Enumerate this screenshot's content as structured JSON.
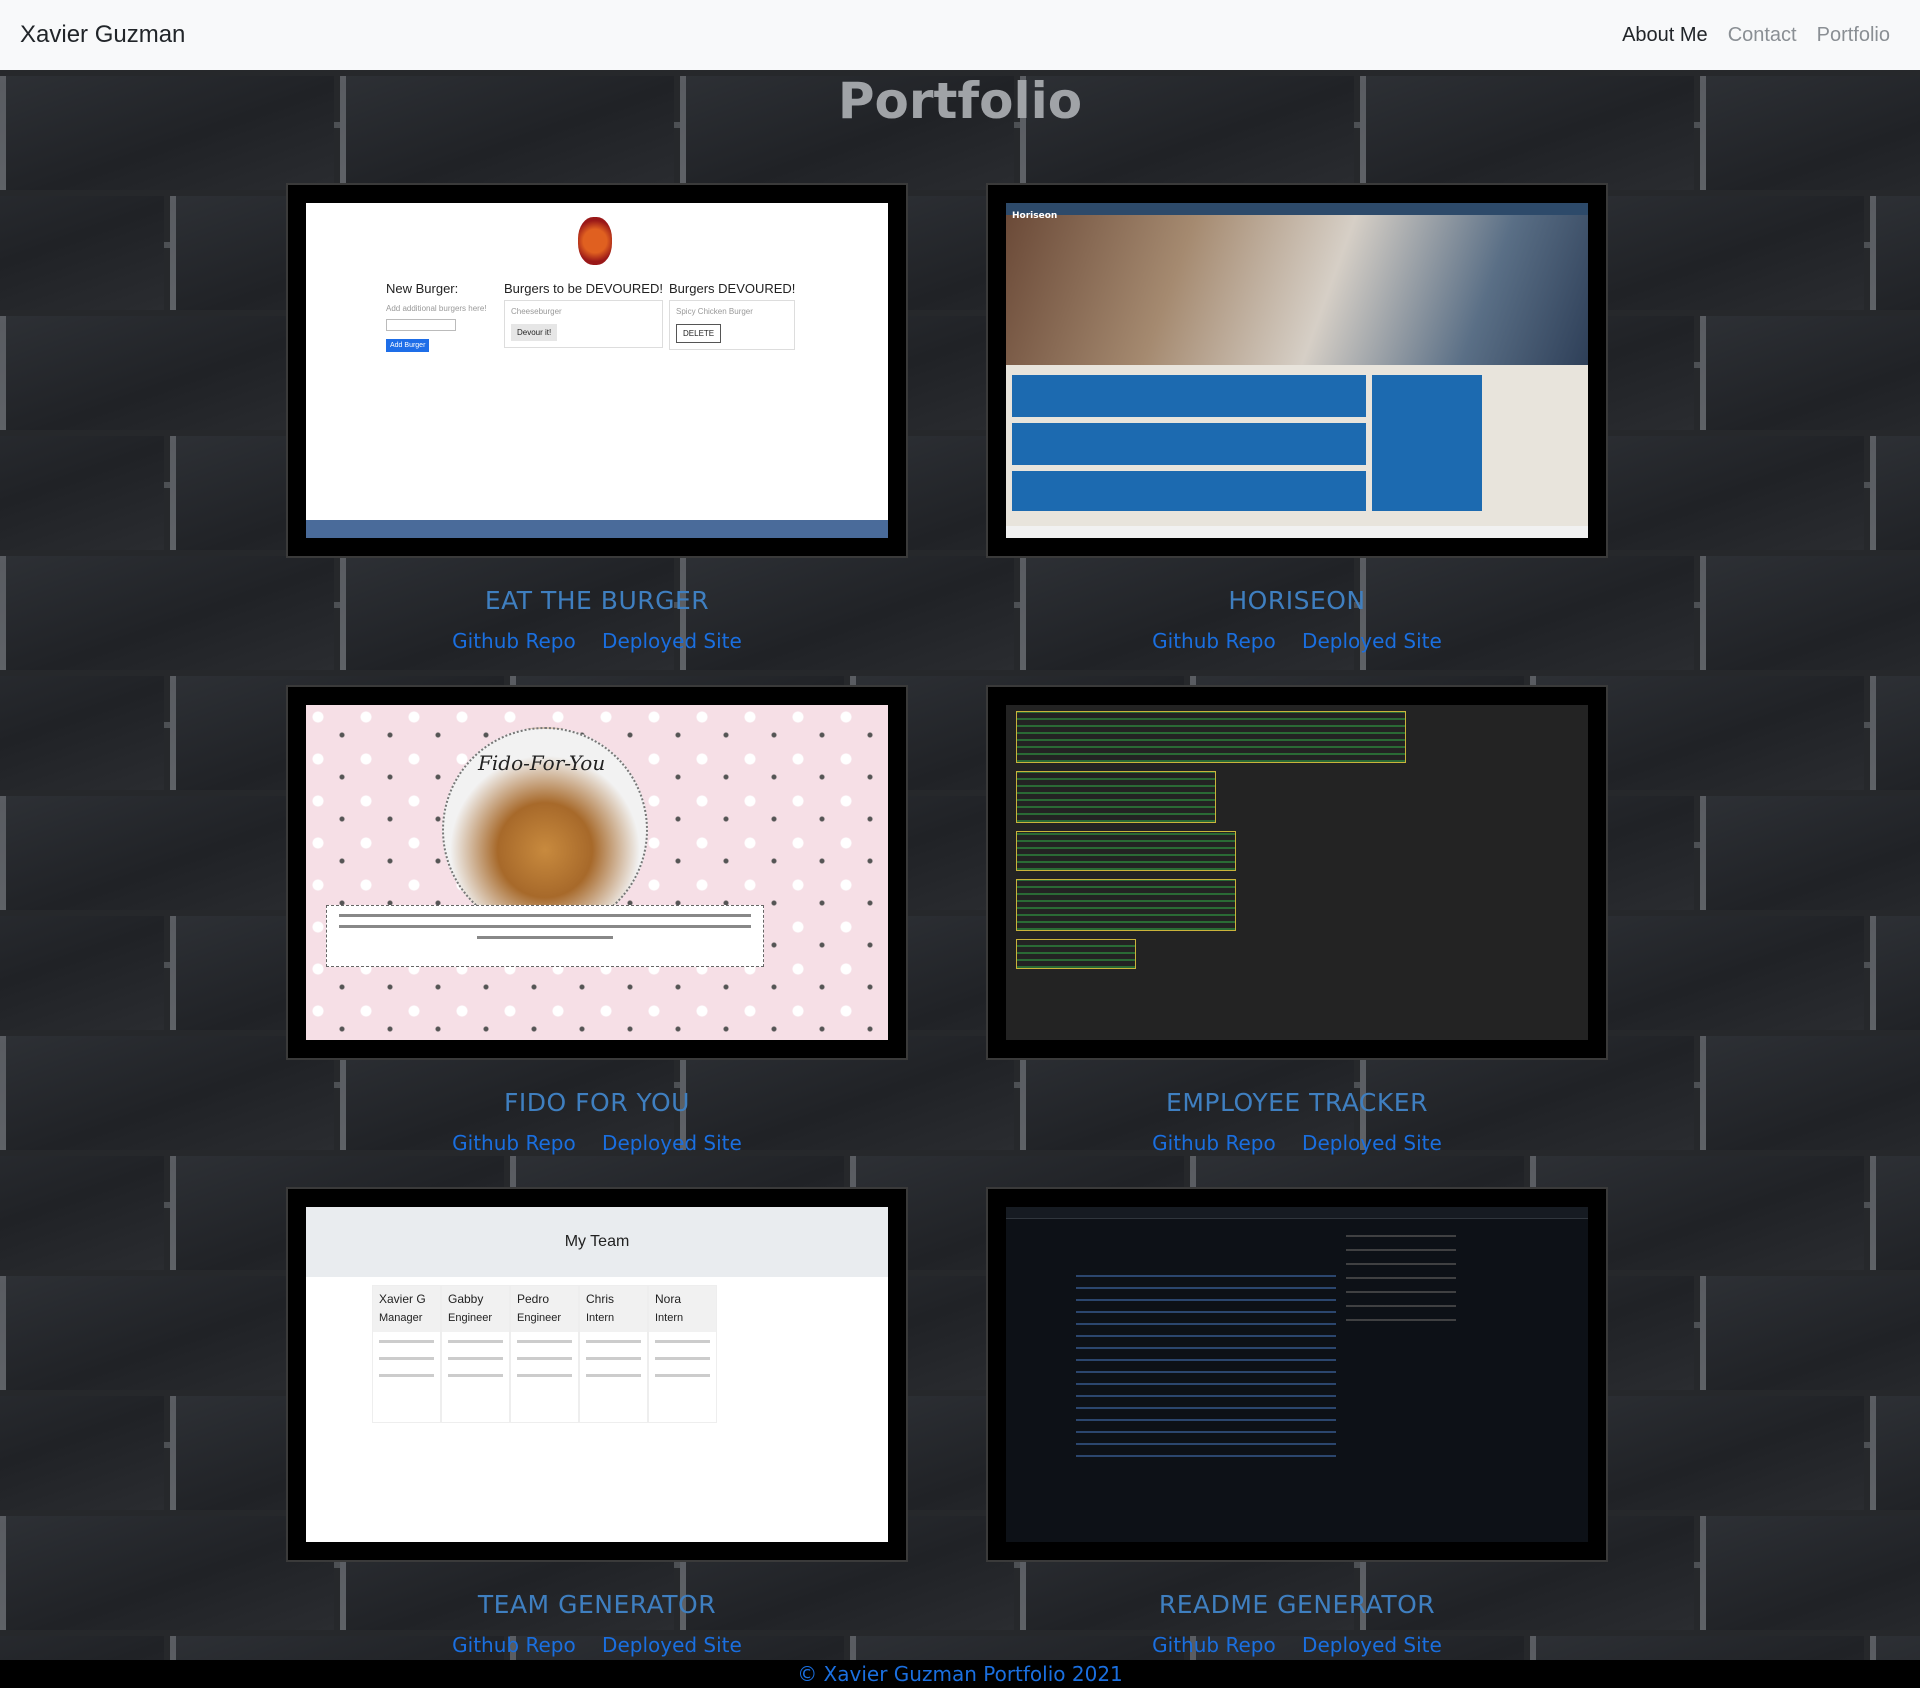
{
  "navbar": {
    "brand": "Xavier Guzman",
    "links": [
      "About Me",
      "Contact",
      "Portfolio"
    ]
  },
  "page": {
    "title": "Portfolio"
  },
  "projects": [
    {
      "title": "EAT THE BURGER",
      "repo_label": "Github Repo",
      "site_label": "Deployed Site",
      "shot": {
        "heading1": "New Burger:",
        "sub1": "Add additional burgers here!",
        "add_btn": "Add Burger",
        "heading2": "Burgers to be DEVOURED!",
        "item2": "Cheeseburger",
        "btn2": "Devour it!",
        "heading3": "Burgers DEVOURED!",
        "item3": "Spicy Chicken Burger",
        "btn3": "DELETE"
      }
    },
    {
      "title": "HORISEON",
      "repo_label": "Github Repo",
      "site_label": "Deployed Site",
      "shot": {
        "brand": "Horiseon"
      }
    },
    {
      "title": "FIDO FOR YOU",
      "repo_label": "Github Repo",
      "site_label": "Deployed Site",
      "shot": {
        "brand": "Fido-For-You"
      }
    },
    {
      "title": "EMPLOYEE TRACKER",
      "repo_label": "Github Repo",
      "site_label": "Deployed Site",
      "shot": {}
    },
    {
      "title": "TEAM GENERATOR",
      "repo_label": "Github Repo",
      "site_label": "Deployed Site",
      "shot": {
        "heading": "My Team",
        "members": [
          {
            "name": "Xavier G",
            "role": "Manager"
          },
          {
            "name": "Gabby",
            "role": "Engineer"
          },
          {
            "name": "Pedro",
            "role": "Engineer"
          },
          {
            "name": "Chris",
            "role": "Intern"
          },
          {
            "name": "Nora",
            "role": "Intern"
          }
        ]
      }
    },
    {
      "title": "README GENERATOR",
      "repo_label": "Github Repo",
      "site_label": "Deployed Site",
      "shot": {}
    }
  ],
  "footer": {
    "text": "© Xavier Guzman Portfolio 2021"
  },
  "colors": {
    "accent": "#1a6fe0",
    "project_title": "#3f7fc0",
    "navbar_bg": "#f8f9fa"
  }
}
